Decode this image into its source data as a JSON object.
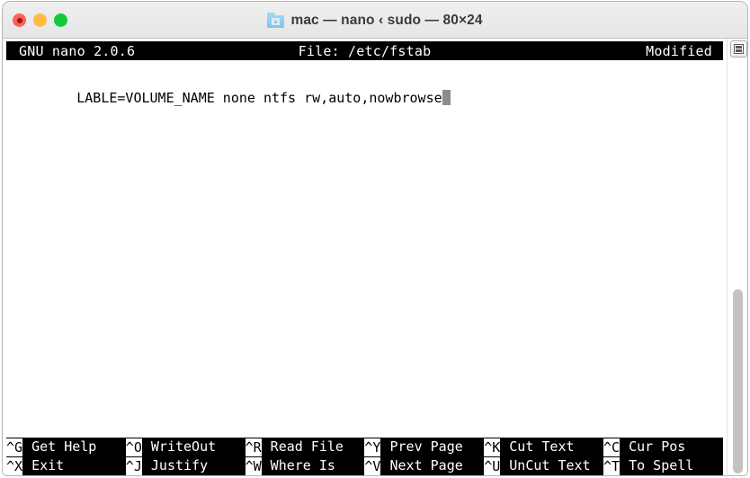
{
  "window": {
    "title": "mac — nano ‹ sudo — 80×24",
    "title_icon": "folder-icon",
    "traffic_lights": {
      "close": "close-button",
      "minimize": "minimize-button",
      "maximize": "maximize-button"
    }
  },
  "nano": {
    "header": {
      "version": "GNU nano 2.0.6",
      "file": "File: /etc/fstab",
      "state": "Modified"
    },
    "buffer": {
      "line_1": "LABLE=VOLUME_NAME none ntfs rw,auto,nowbrowse",
      "cursor": "block-cursor"
    },
    "shortcuts_row_1": [
      {
        "key": "^G",
        "label": "Get Help"
      },
      {
        "key": "^O",
        "label": "WriteOut"
      },
      {
        "key": "^R",
        "label": "Read File"
      },
      {
        "key": "^Y",
        "label": "Prev Page"
      },
      {
        "key": "^K",
        "label": "Cut Text"
      },
      {
        "key": "^C",
        "label": "Cur Pos"
      }
    ],
    "shortcuts_row_2": [
      {
        "key": "^X",
        "label": "Exit"
      },
      {
        "key": "^J",
        "label": "Justify"
      },
      {
        "key": "^W",
        "label": "Where Is"
      },
      {
        "key": "^V",
        "label": "Next Page"
      },
      {
        "key": "^U",
        "label": "UnCut Text"
      },
      {
        "key": "^T",
        "label": "To Spell"
      }
    ]
  },
  "gutter": {
    "split_button": "split-pane-icon",
    "scrollbar": "vertical-scrollbar"
  },
  "colors": {
    "terminal_bg": "#ffffff",
    "terminal_fg": "#000000",
    "bar_bg": "#000000",
    "bar_fg": "#ffffff",
    "cursor": "#8c8c8c",
    "titlebar_bg": "#ebeaea",
    "close": "#fc6058",
    "minimize": "#fdbc40",
    "maximize": "#13ca3c"
  }
}
